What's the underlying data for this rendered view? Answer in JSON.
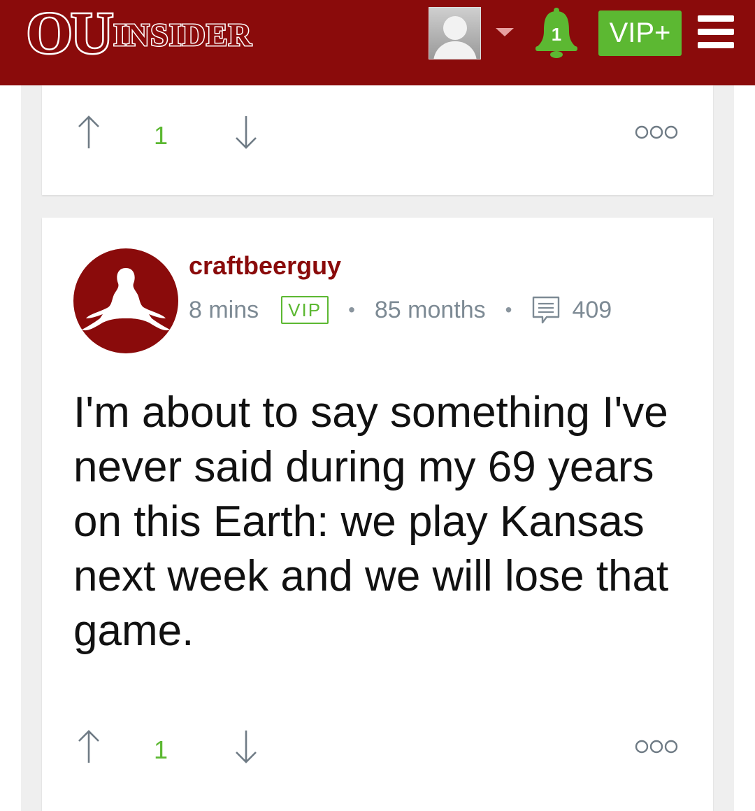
{
  "header": {
    "logo_ou": "OU",
    "logo_insider": "INSIDER",
    "notification_count": "1",
    "vip_label": "VIP+",
    "colors": {
      "brand": "#8a0b0b",
      "accent_green": "#5cb832"
    }
  },
  "icons": {
    "profile": "user-silhouette",
    "dropdown": "caret-down-icon",
    "notifications": "bell-icon",
    "menu": "hamburger-icon",
    "upvote": "arrow-up-icon",
    "downvote": "arrow-down-icon",
    "more": "more-options-icon",
    "messages": "message-icon"
  },
  "previous_post": {
    "vote_count": "1"
  },
  "post": {
    "author": "craftbeerguy",
    "time": "8 mins",
    "badge": "VIP",
    "membership": "85 months",
    "message_count": "409",
    "body": "I'm about to say something I've never said during my 69 years on this Earth: we play Kansas next week and we will lose that game.",
    "vote_count": "1"
  }
}
